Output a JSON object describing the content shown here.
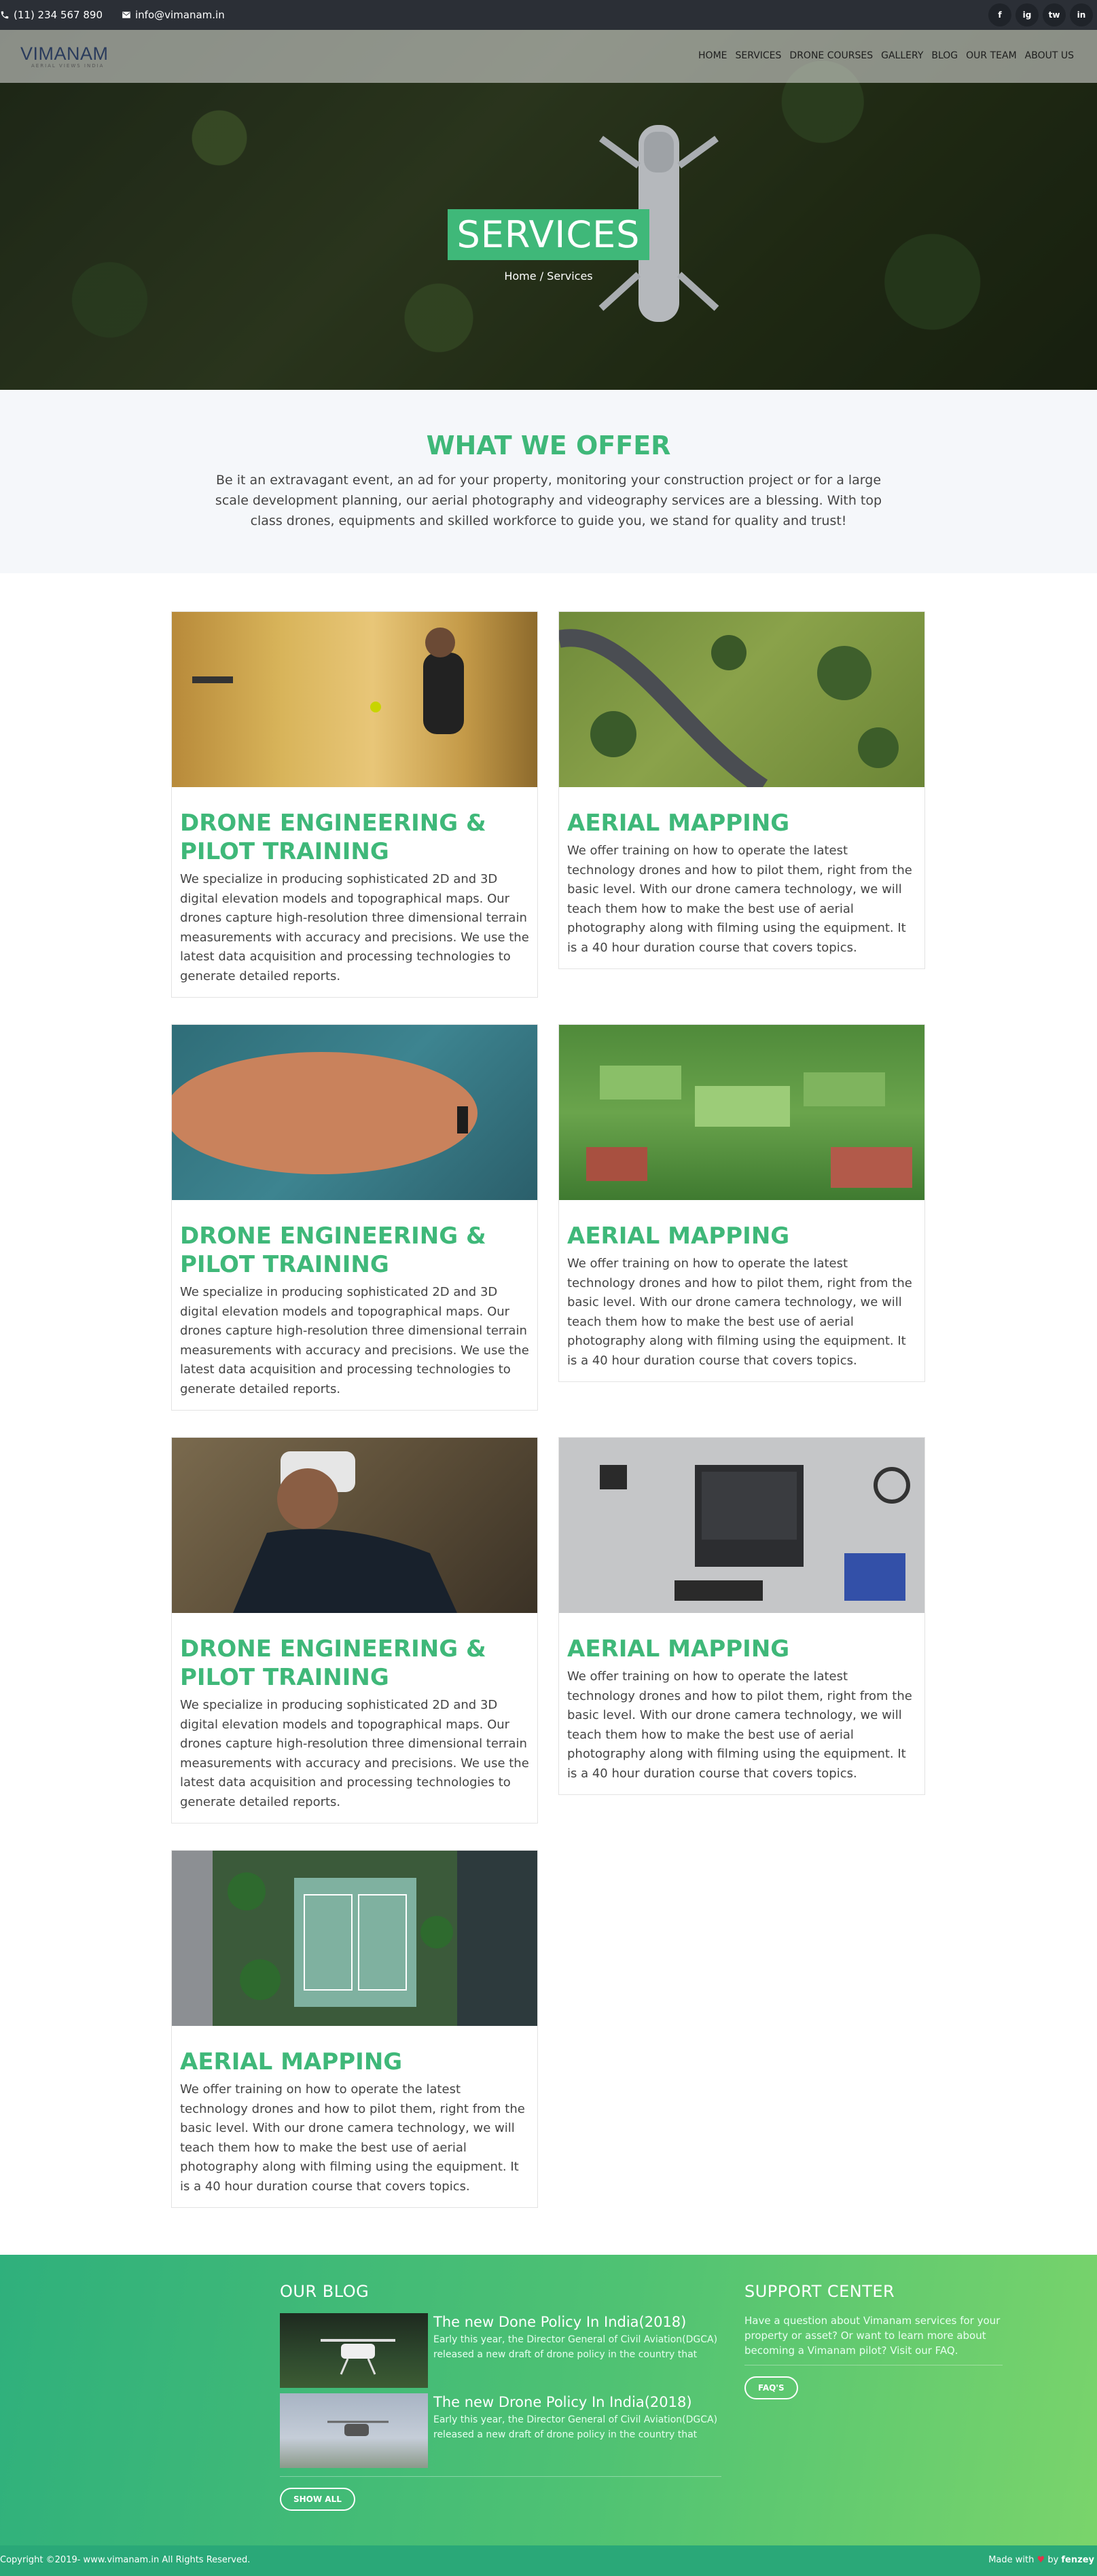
{
  "topbar": {
    "phone": "(11) 234 567 890",
    "email": "info@vimanam.in",
    "social": [
      "f",
      "ig",
      "tw",
      "in"
    ]
  },
  "brand": {
    "logo_text": "VIMANAM",
    "logo_tagline": "AERIAL VIEWS INDIA"
  },
  "nav": [
    "HOME",
    "SERVICES",
    "DRONE COURSES",
    "GALLERY",
    "BLOG",
    "OUR TEAM",
    "ABOUT US"
  ],
  "hero": {
    "title": "SERVICES",
    "breadcrumb": "Home / Services"
  },
  "offer": {
    "title": "WHAT WE OFFER",
    "text": "Be it an extravagant event, an ad for your property, monitoring your construction project or for a large scale development planning, our aerial photography and videography services are a blessing. With top class drones, equipments and skilled workforce to guide you, we stand for quality and trust!"
  },
  "cards": [
    {
      "title": "DRONE ENGINEERING & PILOT TRAINING",
      "text": "We specialize in producing sophisticated 2D and 3D digital elevation models and topographical maps. Our drones capture high-resolution three dimensional terrain measurements with accuracy and precisions. We use the latest data acquisition and processing technologies to generate detailed reports."
    },
    {
      "title": "AERIAL MAPPING",
      "text": "We offer training on how to operate the latest technology drones and how to pilot them, right from the basic level. With our drone camera technology, we will teach them how to make the best use of aerial photography along with filming using the equipment. It is a 40 hour duration course that covers topics."
    },
    {
      "title": "DRONE ENGINEERING & PILOT TRAINING",
      "text": "We specialize in producing sophisticated 2D and 3D digital elevation models and topographical maps. Our drones capture high-resolution three dimensional terrain measurements with accuracy and precisions. We use the latest data acquisition and processing technologies to generate detailed reports."
    },
    {
      "title": "AERIAL MAPPING",
      "text": "We offer training on how to operate the latest technology drones and how to pilot them, right from the basic level. With our drone camera technology, we will teach them how to make the best use of aerial photography along with filming using the equipment. It is a 40 hour duration course that covers topics."
    },
    {
      "title": "DRONE ENGINEERING & PILOT TRAINING",
      "text": "We specialize in producing sophisticated 2D and 3D digital elevation models and topographical maps. Our drones capture high-resolution three dimensional terrain measurements with accuracy and precisions. We use the latest data acquisition and processing technologies to generate detailed reports."
    },
    {
      "title": "AERIAL MAPPING",
      "text": "We offer training on how to operate the latest technology drones and how to pilot them, right from the basic level. With our drone camera technology, we will teach them how to make the best use of aerial photography along with filming using the equipment. It is a 40 hour duration course that covers topics."
    },
    {
      "title": "AERIAL MAPPING",
      "text": "We offer training on how to operate the latest technology drones and how to pilot them, right from the basic level. With our drone camera technology, we will teach them how to make the best use of aerial photography along with filming using the equipment. It is a 40 hour duration course that covers topics."
    }
  ],
  "blog": {
    "title": "OUR BLOG",
    "posts": [
      {
        "title": "The new Done Policy In India(2018)",
        "excerpt": "Early this year, the Director General of Civil Aviation(DGCA) released a new draft of drone policy in the country that"
      },
      {
        "title": "The new Drone Policy In India(2018)",
        "excerpt": "Early this year, the Director General of Civil Aviation(DGCA) released a new draft of drone policy in the country that"
      }
    ],
    "show_all": "SHOW ALL"
  },
  "support": {
    "title": "SUPPORT CENTER",
    "text": "Have a question about Vimanam services for your property or asset? Or want to learn more about becoming a Vimanam pilot? Visit our FAQ.",
    "button": "FAQ'S"
  },
  "footer": {
    "copyright": "Copyright ©2019- www.vimanam.in All Rights Reserved.",
    "made_with": "Made with",
    "by": "by",
    "author": "fenzey"
  },
  "colors": {
    "accent": "#3fb879",
    "topbar": "#2b2f36",
    "footer_start": "#2fb07c",
    "footer_end": "#7ad46b"
  }
}
